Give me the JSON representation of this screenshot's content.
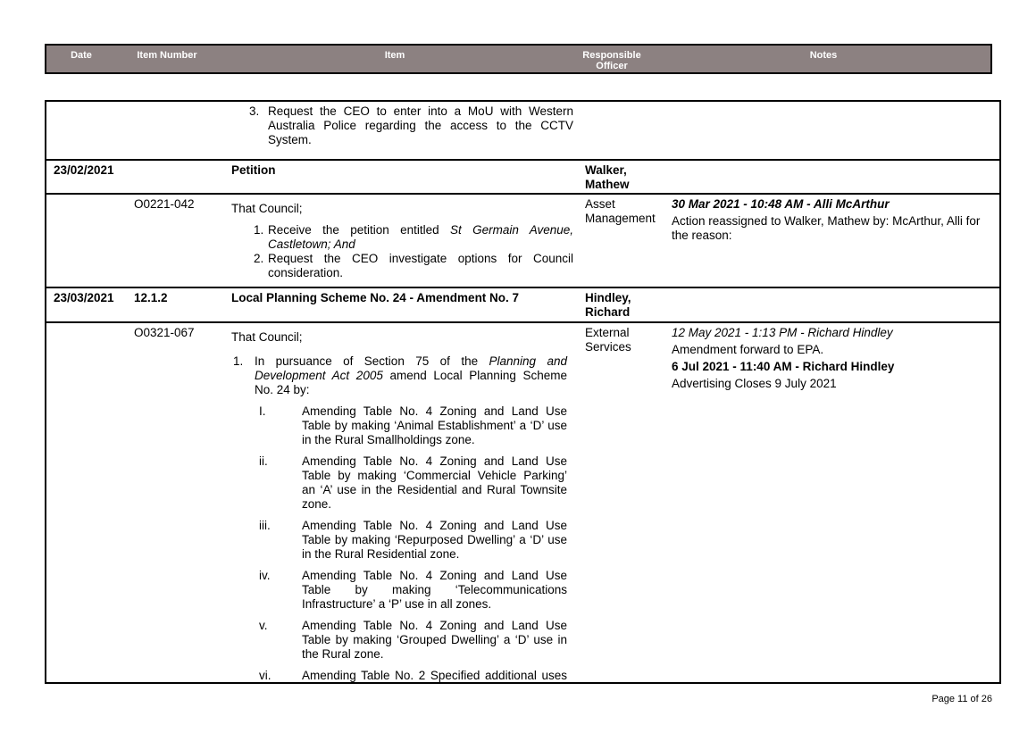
{
  "header": {
    "date": "Date",
    "item_number": "Item Number",
    "item": "Item",
    "responsible_officer_1": "Responsible",
    "responsible_officer_2": "Officer",
    "notes": "Notes"
  },
  "row_continuation": {
    "num": "3.",
    "lines": [
      "Request the CEO to enter into a MoU with Western",
      "Australia Police regarding the access to the CCTV",
      "System."
    ]
  },
  "row_petition": {
    "date": "23/02/2021",
    "title": "Petition",
    "officer_1": "Walker,",
    "officer_2": "Mathew"
  },
  "row_petition_action": {
    "item_number": "O0221-042",
    "intro": "That Council;",
    "p1_num": "1.",
    "p1_a": "Receive the petition entitled ",
    "p1_b": "St Germain Avenue,",
    "p1_line2": "Castletown; And",
    "p2_num": "2.",
    "p2_line1": "Request the CEO investigate options for Council",
    "p2_line2": "consideration.",
    "officer_1": "Asset",
    "officer_2": "Management",
    "note_heading": "30 Mar 2021 - 10:48 AM - Alli McArthur",
    "note_text_1": "Action reassigned to Walker, Mathew by: McArthur, Alli for",
    "note_text_2": "the reason:"
  },
  "row_planning": {
    "date": "23/03/2021",
    "item_number": "12.1.2",
    "title": "Local Planning Scheme No. 24 - Amendment No. 7",
    "officer_1": "Hindley,",
    "officer_2": "Richard"
  },
  "row_planning_action": {
    "item_number": "O0321-067",
    "intro": "That Council;",
    "p1_num": "1.",
    "p1_l1_a": "In pursuance of Section 75 of the ",
    "p1_l1_b": "Planning and",
    "p1_l2_a": "Development Act 2005",
    "p1_l2_b": " amend Local Planning Scheme",
    "p1_l3": "No. 24 by:",
    "subitems": [
      {
        "num": "I.",
        "lines": [
          "Amending Table No. 4 Zoning and Land Use",
          "Table by making ‘Animal Establishment’ a ‘D’ use",
          "in the Rural Smallholdings zone."
        ]
      },
      {
        "num": "ii.",
        "lines": [
          "Amending Table No. 4 Zoning and Land Use",
          "Table by making ‘Commercial Vehicle Parking’",
          "an ‘A’ use in the Residential and Rural Townsite",
          "zone."
        ]
      },
      {
        "num": "iii.",
        "lines": [
          "Amending Table No. 4 Zoning and Land Use",
          "Table by making ‘Repurposed Dwelling’ a ‘D’ use",
          "in the Rural Residential zone."
        ]
      },
      {
        "num": "iv.",
        "lines": [
          "Amending Table No. 4 Zoning and Land Use",
          "Table by making ‘Telecommunications",
          "Infrastructure’ a ‘P’ use in all zones."
        ]
      },
      {
        "num": "v.",
        "lines": [
          "Amending Table No. 4 Zoning and Land Use",
          "Table by making ‘Grouped Dwelling’ a ‘D’ use in",
          "the Rural zone."
        ]
      },
      {
        "num": "vi.",
        "lines": [
          "Amending Table No. 2 Specified additional uses"
        ]
      }
    ],
    "officer_1": "External",
    "officer_2": "Services",
    "note1_heading": "12 May 2021 - 1:13 PM - Richard Hindley",
    "note1_text": "Amendment forward to EPA.",
    "note2_heading": "6 Jul 2021 - 11:40 AM - Richard Hindley",
    "note2_text": "Advertising Closes 9 July 2021"
  },
  "footer": {
    "page": "Page 11 of 26"
  }
}
